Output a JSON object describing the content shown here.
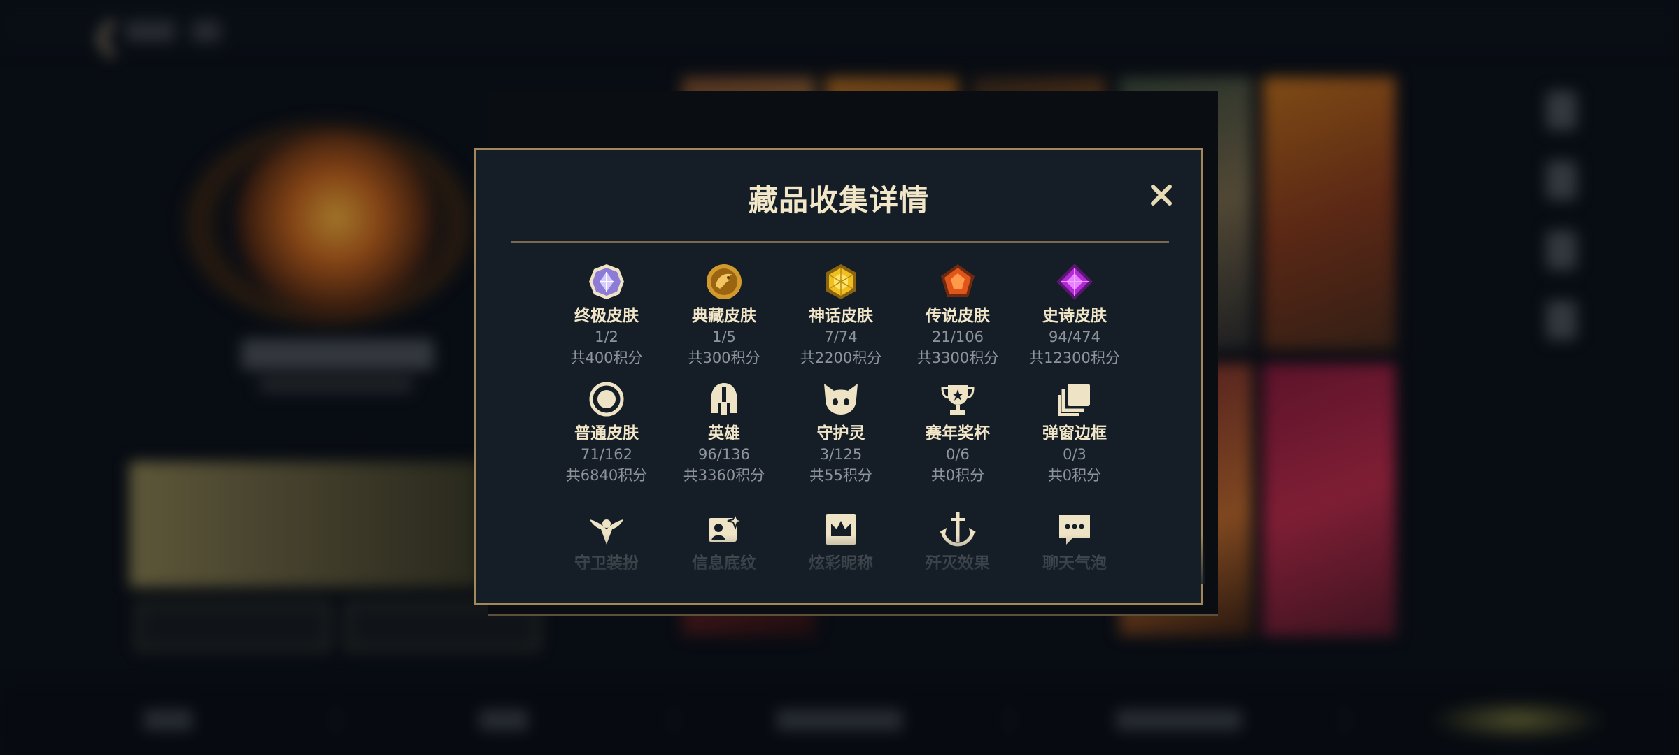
{
  "modal": {
    "title": "藏品收集详情",
    "close_icon": "close-icon",
    "items": [
      {
        "name": "终极皮肤",
        "count": "1/2",
        "points": "共400积分",
        "icon": "ultimate-gem-icon"
      },
      {
        "name": "典藏皮肤",
        "count": "1/5",
        "points": "共300积分",
        "icon": "dragon-gem-icon"
      },
      {
        "name": "神话皮肤",
        "count": "7/74",
        "points": "共2200积分",
        "icon": "mythic-gem-icon"
      },
      {
        "name": "传说皮肤",
        "count": "21/106",
        "points": "共3300积分",
        "icon": "legendary-gem-icon"
      },
      {
        "name": "史诗皮肤",
        "count": "94/474",
        "points": "共12300积分",
        "icon": "epic-gem-icon"
      },
      {
        "name": "普通皮肤",
        "count": "71/162",
        "points": "共6840积分",
        "icon": "ring-icon"
      },
      {
        "name": "英雄",
        "count": "96/136",
        "points": "共3360积分",
        "icon": "helmet-icon"
      },
      {
        "name": "守护灵",
        "count": "3/125",
        "points": "共55积分",
        "icon": "guardian-spirit-icon"
      },
      {
        "name": "赛年奖杯",
        "count": "0/6",
        "points": "共0积分",
        "icon": "trophy-icon"
      },
      {
        "name": "弹窗边框",
        "count": "0/3",
        "points": "共0积分",
        "icon": "frame-icon"
      },
      {
        "name": "守卫装扮",
        "icon": "ward-icon"
      },
      {
        "name": "信息底纹",
        "icon": "info-card-icon"
      },
      {
        "name": "炫彩昵称",
        "icon": "crown-card-icon"
      },
      {
        "name": "歼灭效果",
        "icon": "anchor-icon"
      },
      {
        "name": "聊天气泡",
        "icon": "chat-bubble-icon"
      }
    ]
  },
  "colors": {
    "accent_gold": "#a3895a",
    "title": "#f1e6c8",
    "muted": "#8f949a",
    "panel": "#151e27"
  }
}
